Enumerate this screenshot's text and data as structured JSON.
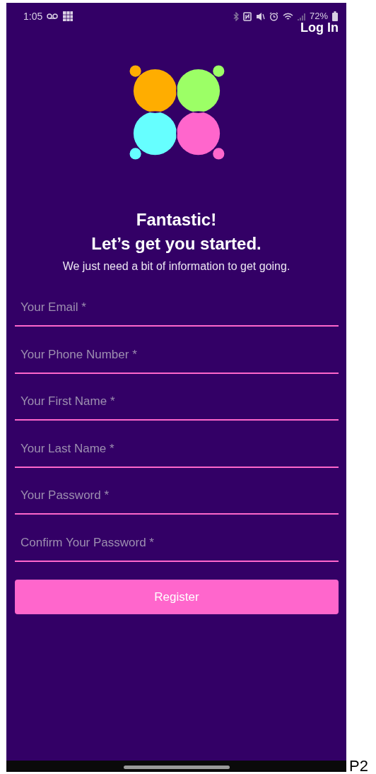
{
  "status_bar": {
    "time": "1:05",
    "battery": "72%"
  },
  "login_link": "Log In",
  "title_lines": [
    "Fantastic!",
    "Let’s get you started."
  ],
  "subtitle": "We just need a bit of information to get going.",
  "fields": [
    {
      "placeholder": "Your Email *"
    },
    {
      "placeholder": "Your Phone Number *"
    },
    {
      "placeholder": "Your First Name *"
    },
    {
      "placeholder": "Your Last Name *"
    },
    {
      "placeholder": "Your Password *"
    },
    {
      "placeholder": "Confirm Your Password *"
    }
  ],
  "register_button": "Register",
  "page_label": "P2"
}
